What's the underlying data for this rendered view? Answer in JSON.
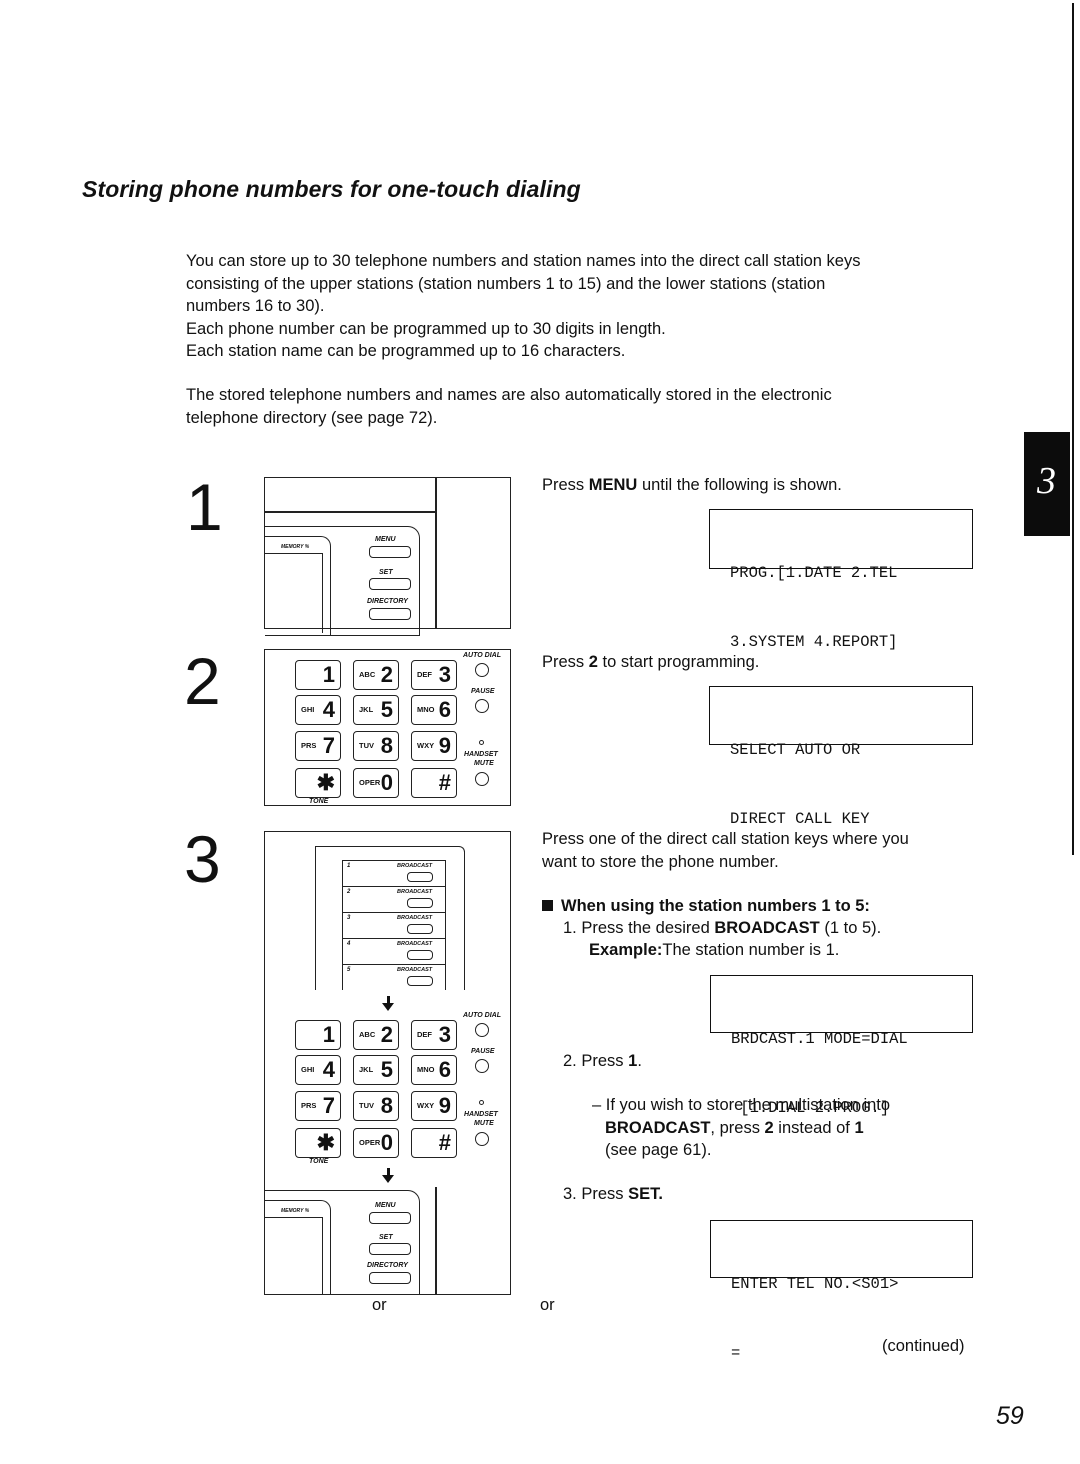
{
  "page": {
    "title": "Storing phone numbers for one-touch dialing",
    "intro_paragraph_1": [
      "You can store up to 30 telephone numbers and station names into the direct call station keys",
      "consisting of the upper stations (station numbers 1 to 15) and the lower stations (station",
      "numbers 16 to 30).",
      "Each phone number can be programmed up to 30 digits in length.",
      "Each station name can be programmed up to 16 characters."
    ],
    "intro_paragraph_2": [
      "The stored telephone numbers and names are also automatically stored in the electronic",
      "telephone directory (see page 72)."
    ],
    "chapter_tab": "3",
    "continued_label": "(continued)",
    "page_number": "59"
  },
  "panel_labels": {
    "memory": "MEMORY %",
    "menu": "MENU",
    "set": "SET",
    "directory": "DIRECTORY",
    "auto_dial": "AUTO DIAL",
    "pause": "PAUSE",
    "handset": "HANDSET",
    "mute": "MUTE",
    "tone": "TONE",
    "broadcast": "BROADCAST"
  },
  "keypad": [
    {
      "letters": "",
      "digit": "1"
    },
    {
      "letters": "ABC",
      "digit": "2"
    },
    {
      "letters": "DEF",
      "digit": "3"
    },
    {
      "letters": "GHI",
      "digit": "4"
    },
    {
      "letters": "JKL",
      "digit": "5"
    },
    {
      "letters": "MNO",
      "digit": "6"
    },
    {
      "letters": "PRS",
      "digit": "7"
    },
    {
      "letters": "TUV",
      "digit": "8"
    },
    {
      "letters": "WXY",
      "digit": "9"
    },
    {
      "letters": "",
      "digit": "✱"
    },
    {
      "letters": "OPER",
      "digit": "0"
    },
    {
      "letters": "",
      "digit": "#"
    }
  ],
  "broadcast_keys": [
    "1",
    "2",
    "3",
    "4",
    "5"
  ],
  "steps": [
    {
      "number": "1",
      "instruction_pre": "Press ",
      "instruction_bold": "MENU",
      "instruction_post": " until the following is shown.",
      "display": [
        "PROG.[1.DATE 2.TEL",
        "3.SYSTEM 4.REPORT]"
      ]
    },
    {
      "number": "2",
      "instruction_pre": "Press ",
      "instruction_bold": "2",
      "instruction_post": " to start programming.",
      "display": [
        "SELECT AUTO OR",
        "DIRECT CALL KEY"
      ]
    },
    {
      "number": "3",
      "instruction": [
        "Press one of the direct call station keys where you",
        "want to store the phone number."
      ],
      "subheading": "When using the station numbers 1 to 5:",
      "substep1_num": "1.",
      "substep1_pre": "Press the desired ",
      "substep1_bold": "BROADCAST",
      "substep1_post": " (1 to 5).",
      "example_label": "Example:",
      "example_text": "The station number is 1.",
      "display_a": [
        "BRDCAST.1 MODE=DIAL",
        " [1.DIAL 2.PROG.]"
      ],
      "substep2_num": "2.",
      "substep2_pre": "Press ",
      "substep2_bold": "1",
      "substep2_post": ".",
      "note_dash": "– If you wish to store the multistation into",
      "note_bold1": "BROADCAST",
      "note_mid": ", press ",
      "note_bold2": "2",
      "note_mid2": " instead of ",
      "note_bold3": "1",
      "note_line3": "(see page 61).",
      "substep3_num": "3.",
      "substep3_pre": "Press ",
      "substep3_bold": "SET.",
      "display_b": [
        "ENTER TEL NO.<S01>",
        "="
      ],
      "or_left": "or",
      "or_right": "or"
    }
  ]
}
